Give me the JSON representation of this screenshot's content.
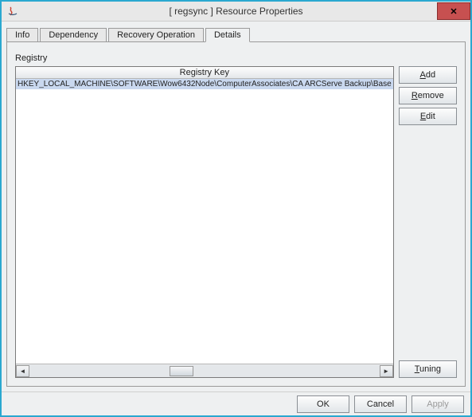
{
  "window": {
    "title": "[ regsync ] Resource Properties",
    "close_glyph": "✕"
  },
  "tabs": {
    "info": "Info",
    "dependency": "Dependency",
    "recovery": "Recovery Operation",
    "details": "Details"
  },
  "details": {
    "registry_label": "Registry",
    "grid_header": "Registry Key",
    "rows": [
      "HKEY_LOCAL_MACHINE\\SOFTWARE\\Wow6432Node\\ComputerAssociates\\CA ARCServe Backup\\Base"
    ],
    "buttons": {
      "add": "Add",
      "remove": "Remove",
      "edit": "Edit",
      "tuning": "Tuning"
    }
  },
  "footer": {
    "ok": "OK",
    "cancel": "Cancel",
    "apply": "Apply"
  },
  "scroll": {
    "left": "◄",
    "right": "►"
  }
}
